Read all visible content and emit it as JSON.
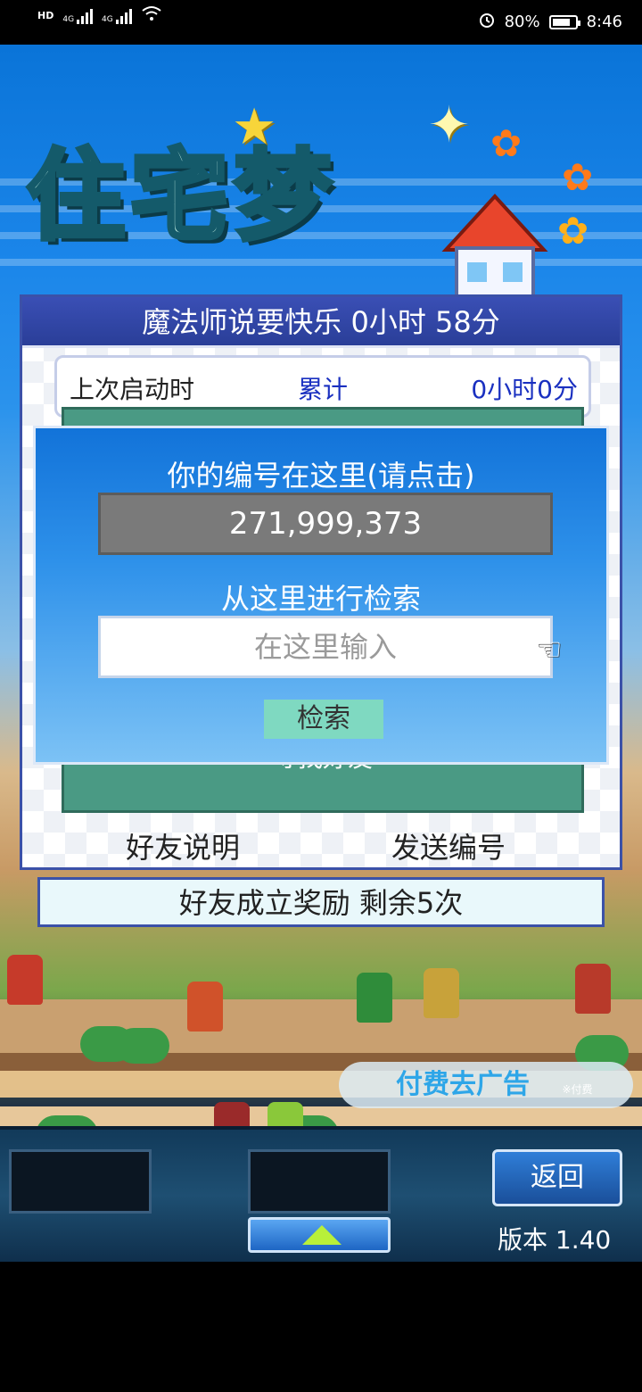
{
  "status_bar": {
    "network_left": "HD",
    "signal_1": "4G",
    "signal_2": "4G",
    "battery_percent": "80%",
    "time": "8:46"
  },
  "game": {
    "logo_text": "住宅梦"
  },
  "panel": {
    "title": "魔法师说要快乐  0小时 58分",
    "stats": {
      "last_launch_label": "上次启动时",
      "total_label": "累计",
      "total_value": "0小时0分"
    },
    "find_friend_label": "寻找好友",
    "friend_help_link": "好友说明",
    "send_id_link": "发送编号"
  },
  "popup": {
    "id_label": "你的编号在这里(请点击)",
    "id_value": "271,999,373",
    "search_label": "从这里进行检索",
    "search_placeholder": "在这里输入",
    "search_button": "检索"
  },
  "reward_bar": {
    "text": "好友成立奖励  剩余5次"
  },
  "ad_banner": {
    "label": "付费去广告",
    "note": "※付费"
  },
  "bottom_bar": {
    "back_button": "返回",
    "version": "版本 1.40"
  },
  "colors": {
    "panel_border": "#3b51a8",
    "popup_top": "#1273d9",
    "id_box": "#7a7a7a",
    "search_button": "#7fd9c1",
    "green_box": "#4a9a84"
  }
}
